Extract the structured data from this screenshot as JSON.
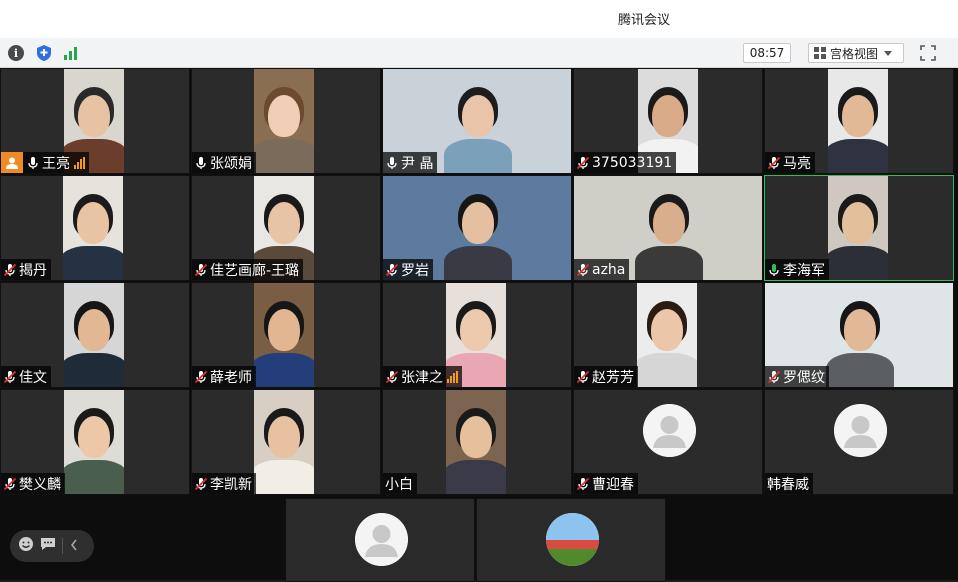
{
  "window": {
    "title": "腾讯会议"
  },
  "toolbar": {
    "time": "08:57",
    "view_label": "宫格视图"
  },
  "participants": [
    {
      "name": "王亮",
      "mic": "on",
      "host": true,
      "speaking": true
    },
    {
      "name": "张颂娟",
      "mic": "on"
    },
    {
      "name": "尹 晶",
      "mic": "on"
    },
    {
      "name": "375033191",
      "mic": "muted"
    },
    {
      "name": "马亮",
      "mic": "muted"
    },
    {
      "name": "揭丹",
      "mic": "muted"
    },
    {
      "name": "佳艺画廊-王璐",
      "mic": "muted"
    },
    {
      "name": "罗岩",
      "mic": "muted"
    },
    {
      "name": "azha",
      "mic": "muted"
    },
    {
      "name": "李海军",
      "mic": "on-green",
      "active": true
    },
    {
      "name": "佳文",
      "mic": "muted"
    },
    {
      "name": "薛老师",
      "mic": "muted"
    },
    {
      "name": "张津之",
      "mic": "muted",
      "speaking": true
    },
    {
      "name": "赵芳芳",
      "mic": "muted"
    },
    {
      "name": "罗偲纹",
      "mic": "muted"
    },
    {
      "name": "樊义麟",
      "mic": "muted"
    },
    {
      "name": "李凯新",
      "mic": "muted"
    },
    {
      "name": "小白",
      "mic": "none"
    },
    {
      "name": "曹迎春",
      "mic": "muted"
    },
    {
      "name": "韩春威",
      "mic": "none"
    }
  ],
  "colors": {
    "accent_green": "#2fbf5a",
    "speaking_orange": "#f39b1c",
    "host_orange": "#f08a24",
    "muted_red": "#e03030"
  }
}
